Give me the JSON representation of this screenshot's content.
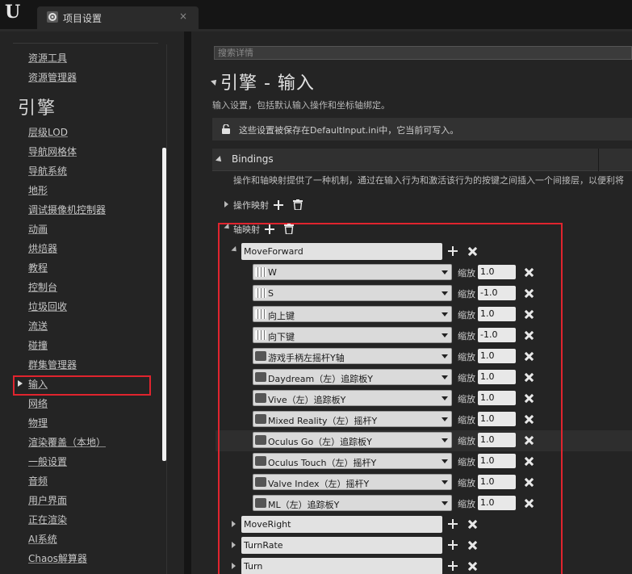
{
  "window": {
    "tab_title": "项目设置",
    "tab_close": "×"
  },
  "nav": {
    "items_top": [
      "资源工具",
      "资源管理器"
    ],
    "heading": "引擎",
    "items": [
      "层级LOD",
      "导航网格体",
      "导航系统",
      "地形",
      "调试摄像机控制器",
      "动画",
      "烘焙器",
      "教程",
      "控制台",
      "垃圾回收",
      "流送",
      "碰撞",
      "群集管理器",
      "输入",
      "网络",
      "物理",
      "渲染覆盖（本地）",
      "一般设置",
      "音频",
      "用户界面",
      "正在渲染",
      "AI系统",
      "Chaos解算器"
    ],
    "selected": "输入"
  },
  "search": {
    "placeholder": "搜索详情"
  },
  "page": {
    "title": "引擎 - 输入",
    "description": "输入设置，包括默认输入操作和坐标轴绑定。",
    "notice": "这些设置被保存在DefaultInput.ini中，它当前可写入。"
  },
  "bindings": {
    "header": "Bindings",
    "description": "操作和轴映射提供了一种机制，通过在输入行为和激活该行为的按键之间插入一个间接层，以便利将",
    "action_mappings_label": "操作映射",
    "axis_mappings_label": "轴映射",
    "scale_label": "缩放",
    "expanded_mapping": {
      "name": "MoveForward",
      "keys": [
        {
          "key": "W",
          "scale": "1.0",
          "icon": "keyboard-icon"
        },
        {
          "key": "S",
          "scale": "-1.0",
          "icon": "keyboard-icon"
        },
        {
          "key": "向上键",
          "scale": "1.0",
          "icon": "keyboard-icon"
        },
        {
          "key": "向下键",
          "scale": "-1.0",
          "icon": "keyboard-icon"
        },
        {
          "key": "游戏手柄左摇杆Y轴",
          "scale": "1.0",
          "icon": "gamepad-icon"
        },
        {
          "key": "Daydream（左）追踪板Y",
          "scale": "1.0",
          "icon": "gamepad-icon"
        },
        {
          "key": "Vive（左）追踪板Y",
          "scale": "1.0",
          "icon": "gamepad-icon"
        },
        {
          "key": "Mixed Reality（左）摇杆Y",
          "scale": "1.0",
          "icon": "gamepad-icon"
        },
        {
          "key": "Oculus Go（左）追踪板Y",
          "scale": "1.0",
          "icon": "gamepad-icon"
        },
        {
          "key": "Oculus Touch（左）摇杆Y",
          "scale": "1.0",
          "icon": "gamepad-icon"
        },
        {
          "key": "Valve Index（左）摇杆Y",
          "scale": "1.0",
          "icon": "gamepad-icon"
        },
        {
          "key": "ML（左）追踪板Y",
          "scale": "1.0",
          "icon": "gamepad-icon"
        }
      ]
    },
    "collapsed_mappings": [
      "MoveRight",
      "TurnRate",
      "Turn"
    ]
  },
  "colors": {
    "highlight": "#e0242e",
    "panel": "#242424",
    "field": "#dadada"
  }
}
